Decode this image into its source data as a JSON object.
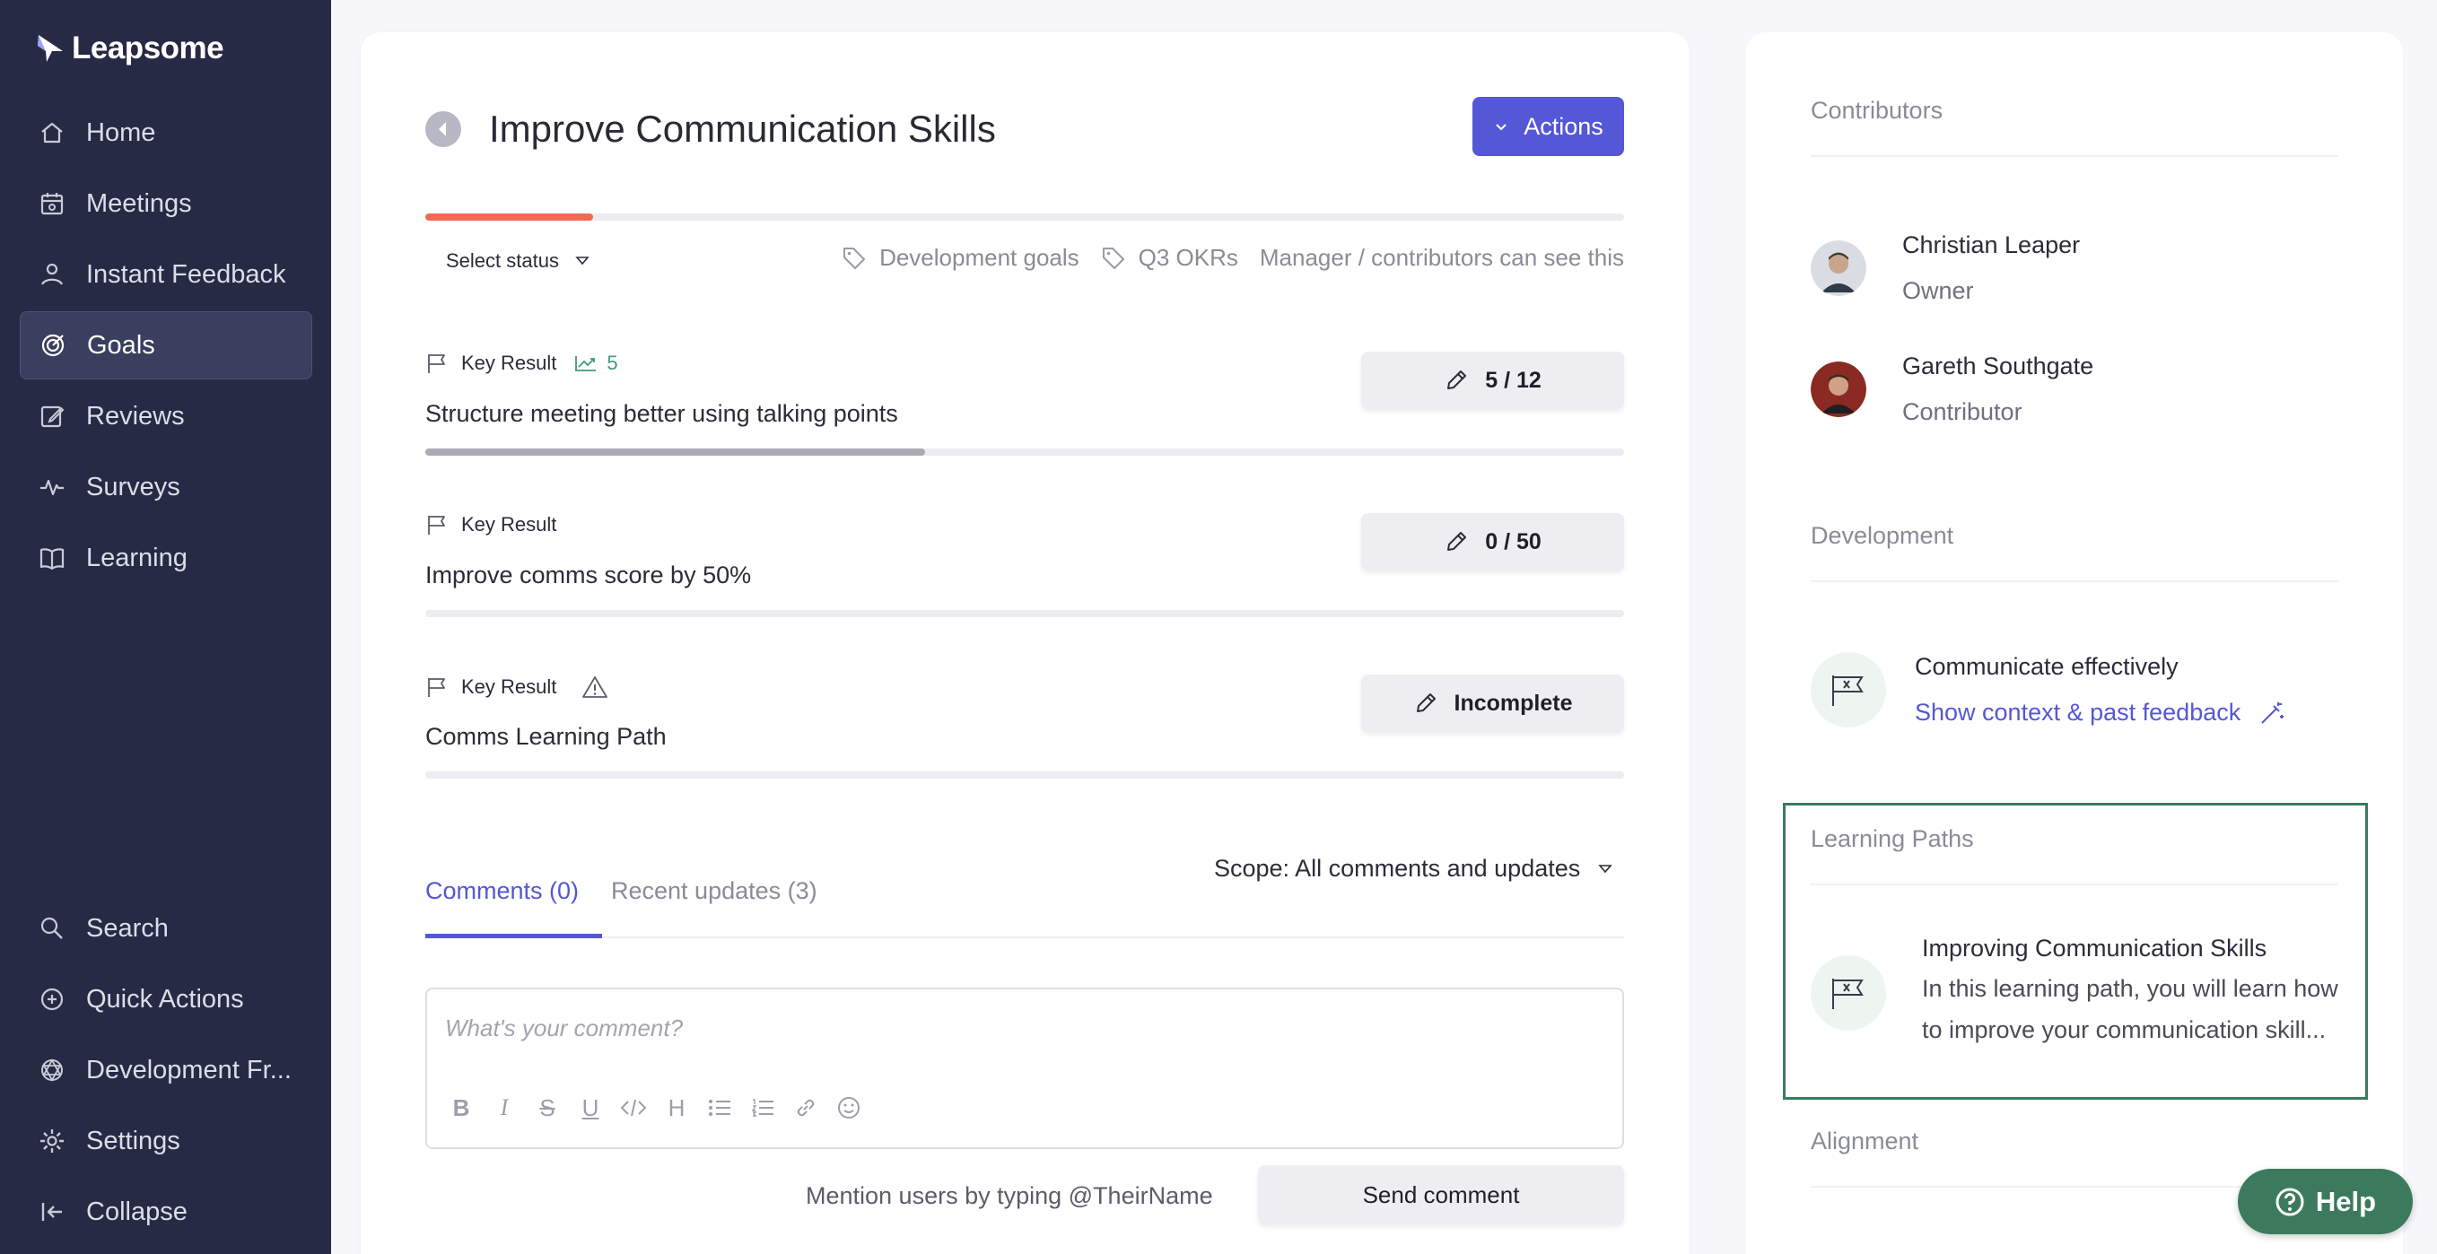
{
  "brand": {
    "name": "Leapsome"
  },
  "sidebar": {
    "items": [
      {
        "label": "Home",
        "icon": "home-icon"
      },
      {
        "label": "Meetings",
        "icon": "meetings-icon"
      },
      {
        "label": "Instant Feedback",
        "icon": "feedback-icon"
      },
      {
        "label": "Goals",
        "icon": "target-icon",
        "active": true
      },
      {
        "label": "Reviews",
        "icon": "edit-icon"
      },
      {
        "label": "Surveys",
        "icon": "pulse-icon"
      },
      {
        "label": "Learning",
        "icon": "book-icon"
      }
    ],
    "bottom_items": [
      {
        "label": "Search",
        "icon": "search-icon"
      },
      {
        "label": "Quick Actions",
        "icon": "plus-circle-icon"
      },
      {
        "label": "Development Fr...",
        "icon": "framework-icon"
      },
      {
        "label": "Settings",
        "icon": "gear-icon"
      },
      {
        "label": "Collapse",
        "icon": "collapse-icon"
      }
    ]
  },
  "goal": {
    "title": "Improve Communication Skills",
    "actions_label": "Actions",
    "progress": 0.14,
    "status_label": "Select status",
    "tags": [
      "Development goals",
      "Q3 OKRs"
    ],
    "visibility": "Manager / contributors can see this"
  },
  "key_results": [
    {
      "label": "Key Result",
      "trend_value": "5",
      "title": "Structure meeting better using talking points",
      "value_label": "5 / 12",
      "progress": 0.4167
    },
    {
      "label": "Key Result",
      "title": "Improve comms score by 50%",
      "value_label": "0 / 50",
      "progress": 0
    },
    {
      "label": "Key Result",
      "warning": true,
      "title": "Comms Learning Path",
      "value_label": "Incomplete",
      "progress": 0
    }
  ],
  "comments": {
    "tab_active": "Comments (0)",
    "tab_inactive": "Recent updates (3)",
    "scope": "Scope: All comments and updates",
    "placeholder": "What's your comment?",
    "mention_hint": "Mention users by typing @TheirName",
    "send_label": "Send comment"
  },
  "side": {
    "contributors_label": "Contributors",
    "contributors": [
      {
        "name": "Christian Leaper",
        "role": "Owner"
      },
      {
        "name": "Gareth Southgate",
        "role": "Contributor"
      }
    ],
    "development_label": "Development",
    "development": {
      "title": "Communicate effectively",
      "link": "Show context & past feedback"
    },
    "learning_label": "Learning Paths",
    "learning": {
      "title": "Improving Communication Skills",
      "desc": "In this learning path, you will learn how to improve your communication skill..."
    },
    "alignment_label": "Alignment"
  },
  "help": {
    "label": "Help"
  },
  "colors": {
    "sidebar": "#272a45",
    "accent": "#5457d6",
    "progress": "#ef6b53",
    "help": "#3c7a5d"
  }
}
